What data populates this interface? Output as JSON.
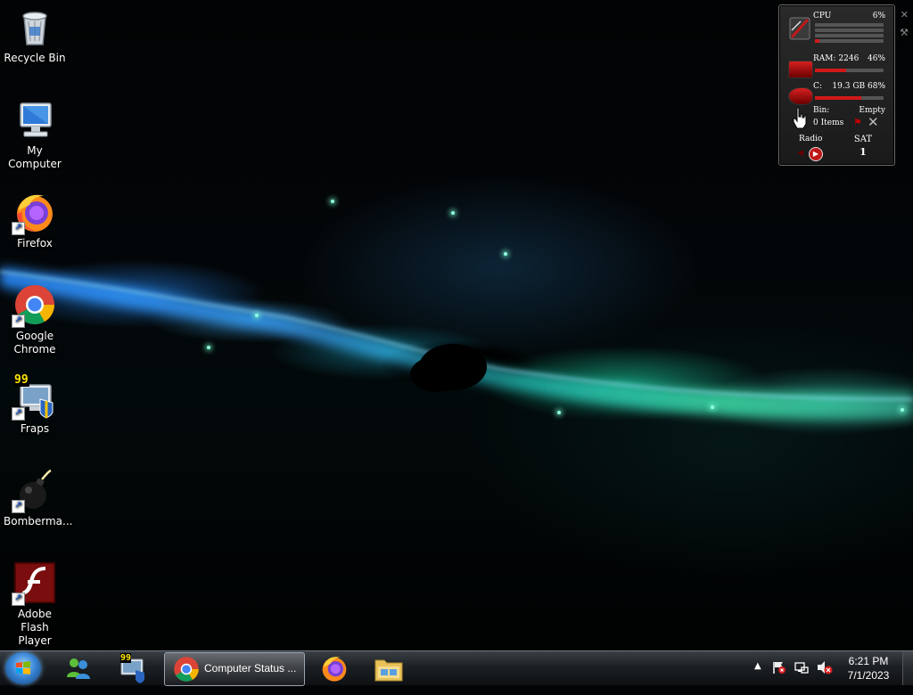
{
  "desktop": {
    "icons": [
      {
        "label": "Recycle Bin"
      },
      {
        "label": "My Computer"
      },
      {
        "label": "Firefox"
      },
      {
        "label": "Google Chrome"
      },
      {
        "label": "Fraps"
      },
      {
        "label": "Bomberma..."
      },
      {
        "label": "Adobe Flash Player"
      }
    ],
    "fraps_badge": "99"
  },
  "gadget": {
    "cpu_label": "CPU",
    "cpu_percent": "6%",
    "cpu_level": 0.06,
    "ram_label": "RAM: 2246",
    "ram_percent": "46%",
    "ram_level": 0.46,
    "disk_label": "C:",
    "disk_value": "19.3 GB 68%",
    "disk_level": 0.68,
    "bin_label": "Bin:",
    "bin_status": "Empty",
    "bin_items": "0 Items",
    "radio_label": "Radio",
    "day": "SAT",
    "date": "1"
  },
  "taskbar": {
    "active_window_title": "Computer Status ...",
    "fraps_badge": "99",
    "clock_time": "6:21 PM",
    "clock_date": "7/1/2023"
  },
  "colors": {
    "gadget_red": "#d01818",
    "taskbar_dark": "#1c2024",
    "wallpaper_glow": "#30dca8"
  }
}
